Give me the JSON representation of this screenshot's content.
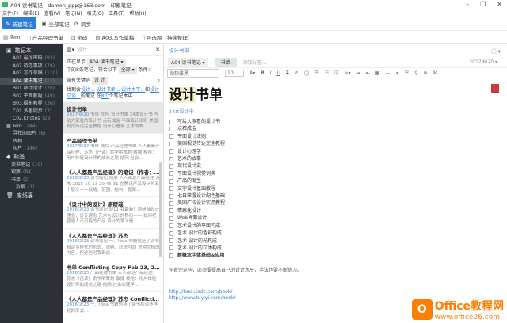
{
  "window": {
    "title": "A04.读书笔记 - damen_ppp@163.com - 印象笔记",
    "minimize": "–",
    "maximize": "❐",
    "close": "✕"
  },
  "menu": [
    "文件(F)",
    "编辑(E)",
    "查看(V)",
    "笔记(N)",
    "格式(O)",
    "工具(T)",
    "帮助(H)"
  ],
  "toolbar": {
    "new_note": "新建笔记",
    "all_notes": "全部笔记",
    "sync": "同步"
  },
  "shortcuts": [
    "Tem",
    "产品经理书单",
    "密码",
    "A03.写作草稿",
    "可选题（持续整理）"
  ],
  "sidebar": {
    "notebooks_header": "笔记本",
    "notebooks": [
      {
        "label": "A01.最优密码",
        "count": "(93)"
      },
      {
        "label": "A02.待办事项",
        "count": "(79)"
      },
      {
        "label": "A03.写作草稿",
        "count": "(110)"
      },
      {
        "label": "A04.读书笔记",
        "count": "(11)",
        "selected": true
      },
      {
        "label": "B01.移动设计",
        "count": "(20)"
      },
      {
        "label": "B02.平面教程",
        "count": "(49)"
      },
      {
        "label": "B03.摄影教程",
        "count": "(36)"
      },
      {
        "label": "C01.多番同步",
        "count": "(2)"
      },
      {
        "label": "C02.Knotes",
        "count": "(28)"
      }
    ],
    "stack": {
      "label": "Tem",
      "count": "(144)"
    },
    "stack_items": [
      {
        "label": "寻找的图片",
        "count": "(6)"
      },
      {
        "label": "残相",
        "count": ""
      },
      {
        "label": "灰片",
        "count": "(146)"
      }
    ],
    "tags_header": "标签",
    "tags": [
      {
        "label": "读书笔记",
        "count": "(10)",
        "lvl": "l3"
      },
      {
        "label": "观察",
        "count": "(84)",
        "lvl": "l3"
      },
      {
        "label": "书单",
        "count": "(2)",
        "lvl": "l3"
      },
      {
        "label": "拆解",
        "count": "(1)",
        "lvl": "l4"
      }
    ],
    "trash": "废纸篓"
  },
  "notelist": {
    "search_placeholder": "设计",
    "showing_label": "正在显示",
    "notebook": "A04.读书笔记 ▾",
    "count_text": "中的8条笔记，符合以下",
    "all": "全部 ▾",
    "condition": "条件：",
    "keyword_label": "含有关键词",
    "keyword": "设 计",
    "found": "找到含",
    "l1": "设计...",
    "l2": "设计书单...",
    "l3": "设计水平...",
    "and": "和",
    "l4": "设计交谈...",
    "in_notes": "的笔记 在",
    "l5": "8个",
    "suffix": "个笔记本中",
    "notes": [
      {
        "title": "设计书单",
        "date": "2017/6/20",
        "snippet": "书单 在Ps 设计书单 34本设计书 写给大家看的设计书 点石成金 平面设计法则 美国视觉传达完全教程 设计心理学 艺术的故...",
        "selected": true
      },
      {
        "title": "产品经理书单",
        "date": "2017/5/17",
        "snippet": "书单 随后 产品经理书单 人人都是产品经理，苏杰（已读）俞学明策划 敏捷 梭哈：用户体验设计师的成长之路 结网 社会..."
      },
      {
        "title": "《人人都是产品经理》的笔记（作者：...",
        "date": "2016/2/23",
        "snippet": "读书笔记 随后 人人都是产品经理 苏杰 2015-10-13 20:46:31 在腾讯产品设计的五个层次——战略、范围、结构、框架..."
      },
      {
        "title": "《设计中的设计》原研哉",
        "date": "2016/2/23",
        "snippet": "读书笔记 5/11 我最新！原研哉设计理念，设计理念 艺术与设计的界线—— 如何把普通人不可能的产品 设计的意义是..."
      },
      {
        "title": "《人人都是产品经理》苏杰",
        "date": "2016/2/23",
        "snippet": "读书笔记 一、Idea 书籍包括了读书和读多样化的形式，观察、比较PRD 说明文档的内容，但这些对我来说..."
      },
      {
        "title": "书单 Conflicting Copy Feb 23, 2016 at...",
        "date": "2016/2/23",
        "snippet": "产品经理书单 人人都是产品经理，苏杰（已读）俞学明策划 敏捷 梭哈：用户体验设计师的成长之路 结网 社会心理学..."
      },
      {
        "title": "《人人都是产品经理》苏杰 Conflicting ...",
        "date": "2016/2/23",
        "snippet": "一、Idea 书籍包括了读书和读多样化的形式..."
      }
    ]
  },
  "editor": {
    "breadcrumb": "设计书单",
    "notebook": "A04.读书笔记 ▾",
    "tag": "书单",
    "add_tag": "添加标签...",
    "date": "2017/6/20 ▾",
    "font": "微软雅黑",
    "size": "10",
    "title_hl": "设计",
    "title_rest": "书单",
    "subtitle": "34本设计书",
    "books": [
      "写给大家看的设计书",
      "点石成金",
      "平面设计法则",
      "美国视觉传达完全教程",
      "设计心理学",
      "艺术的故事",
      "现代设计史",
      "平面设计视觉词典",
      "产品的诞生",
      "文字设计基础教程",
      "七日掌握设计配色基础",
      "美国广告设计实用教程",
      "情感化设计",
      "Web界面设计",
      "艺术设计的平面构成",
      "艺术 设计的色彩构成",
      "艺术 设计的光构成",
      "艺术 设计的立体构成",
      "新概念字体基础&应用"
    ],
    "paragraph": "先看完这些，必须要提高自己的设计水平，手法也要不断练习。",
    "urls": [
      "http://hao.uisdc.com/book/",
      "http://www.tuyiyi.com/book/"
    ]
  },
  "watermark": {
    "brand": "Office教程网",
    "url": "www.office26.com"
  }
}
